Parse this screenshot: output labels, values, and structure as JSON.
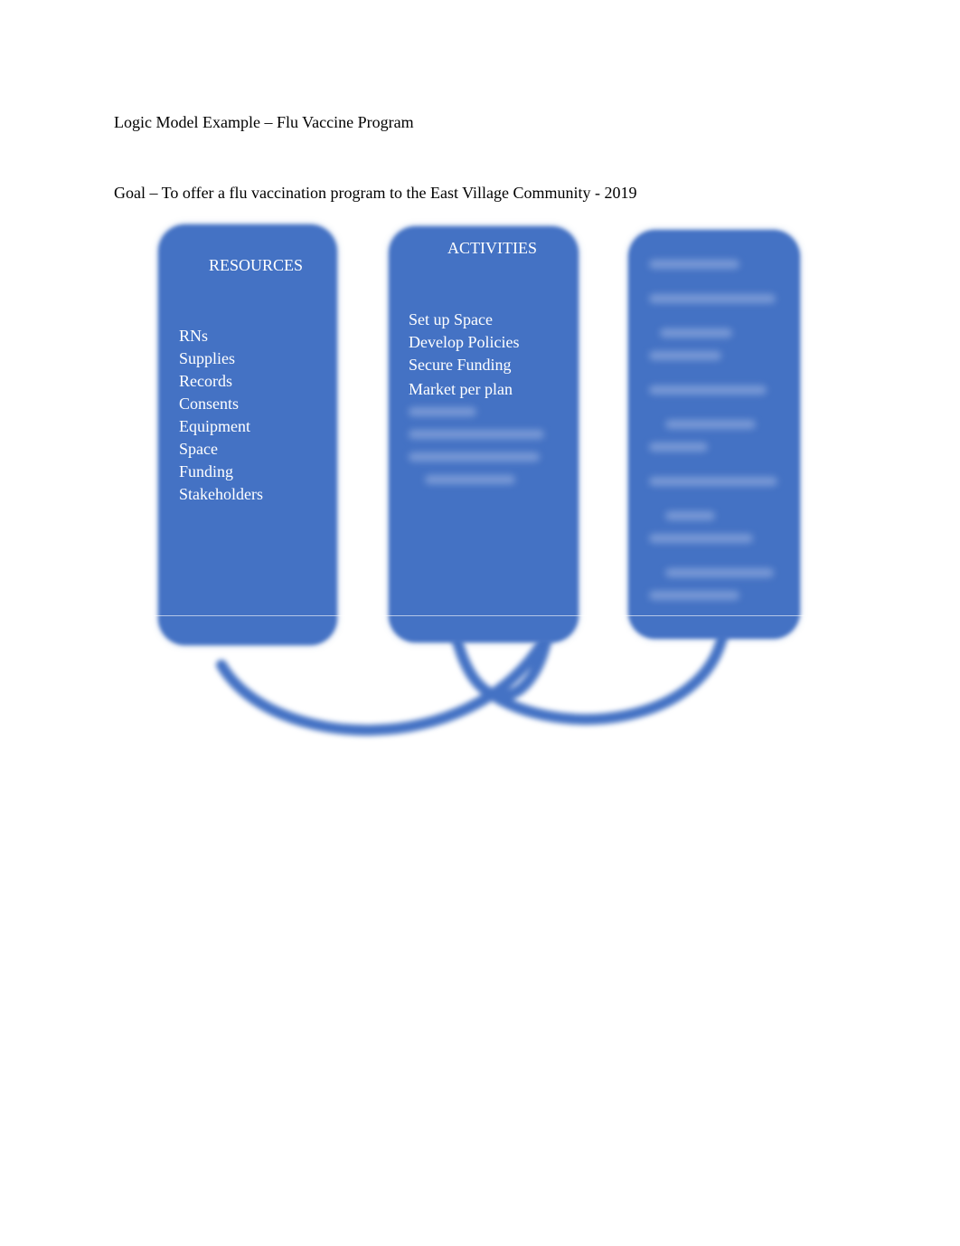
{
  "document": {
    "title": "Logic Model Example – Flu Vaccine Program",
    "goal": "Goal – To offer a flu vaccination program to the East Village Community - 2019"
  },
  "diagram": {
    "accent_color": "#4472c4",
    "resources": {
      "heading": "RESOURCES",
      "items": [
        "RNs",
        "Supplies",
        "Records",
        "Consents",
        "Equipment",
        "Space",
        "Funding",
        "Stakeholders"
      ]
    },
    "activities": {
      "heading": "ACTIVITIES",
      "items": [
        "Set up Space",
        "Develop  Policies",
        "Secure Funding",
        "Market per plan"
      ],
      "obscured": true
    },
    "outcomes": {
      "obscured": true
    }
  }
}
